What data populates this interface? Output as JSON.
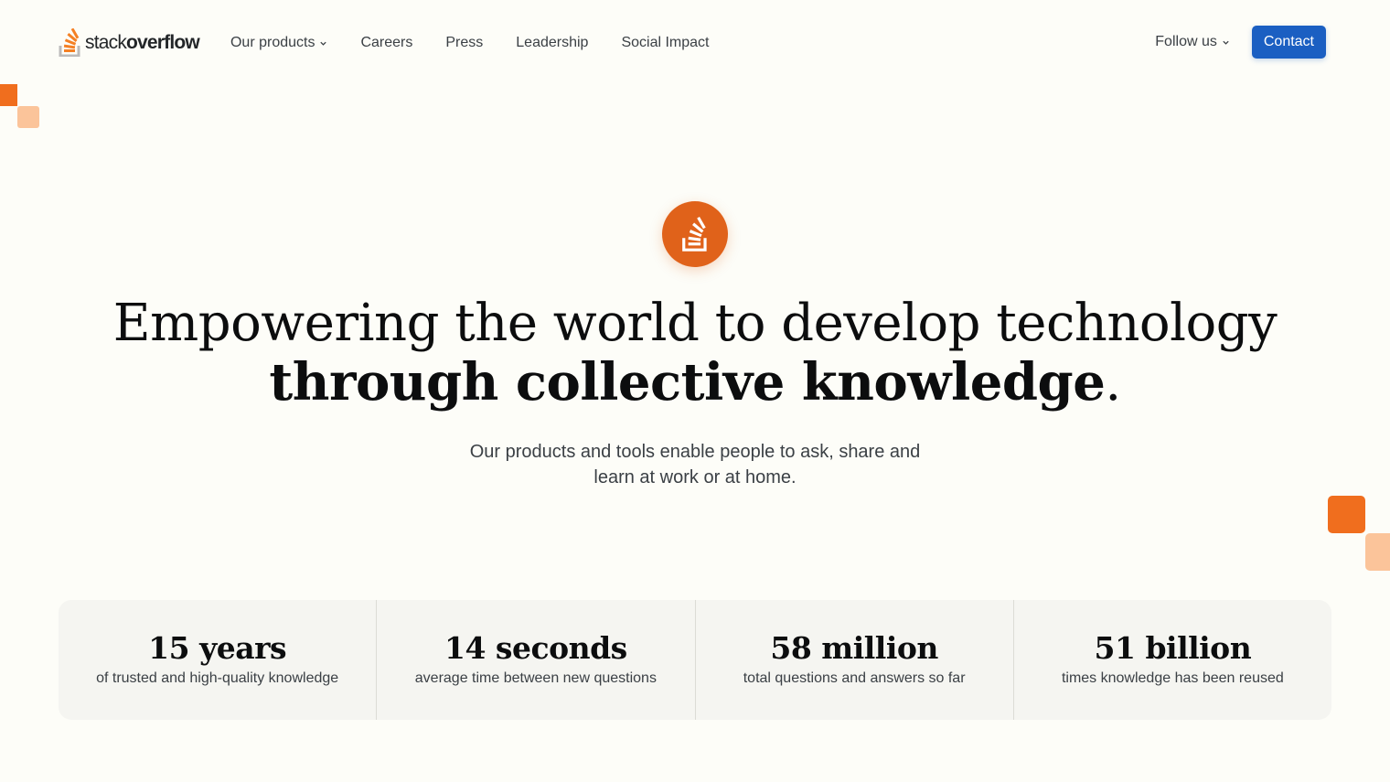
{
  "brand": {
    "name_light": "stack",
    "name_bold": "overflow",
    "colors": {
      "orange": "#f48024",
      "orange_dark": "#e0621a",
      "peach": "#fbc49a",
      "contact_blue": "#1b5fc2"
    }
  },
  "nav": {
    "items": [
      {
        "label": "Our products",
        "has_dropdown": true
      },
      {
        "label": "Careers",
        "has_dropdown": false
      },
      {
        "label": "Press",
        "has_dropdown": false
      },
      {
        "label": "Leadership",
        "has_dropdown": false
      },
      {
        "label": "Social Impact",
        "has_dropdown": false
      }
    ],
    "follow_label": "Follow us",
    "contact_label": "Contact"
  },
  "hero": {
    "icon": "stack-overflow-icon",
    "headline_line1": "Empowering the world to develop technology",
    "headline_line2": "through collective knowledge",
    "headline_end": ".",
    "subtitle_line1": "Our products and tools enable people to ask, share and",
    "subtitle_line2": "learn at work or at home."
  },
  "stats": [
    {
      "value": "15 years",
      "label": "of trusted and high-quality knowledge"
    },
    {
      "value": "14 seconds",
      "label": "average time between new questions"
    },
    {
      "value": "58 million",
      "label": "total questions and answers so far"
    },
    {
      "value": "51 billion",
      "label": "times knowledge has been reused"
    }
  ]
}
